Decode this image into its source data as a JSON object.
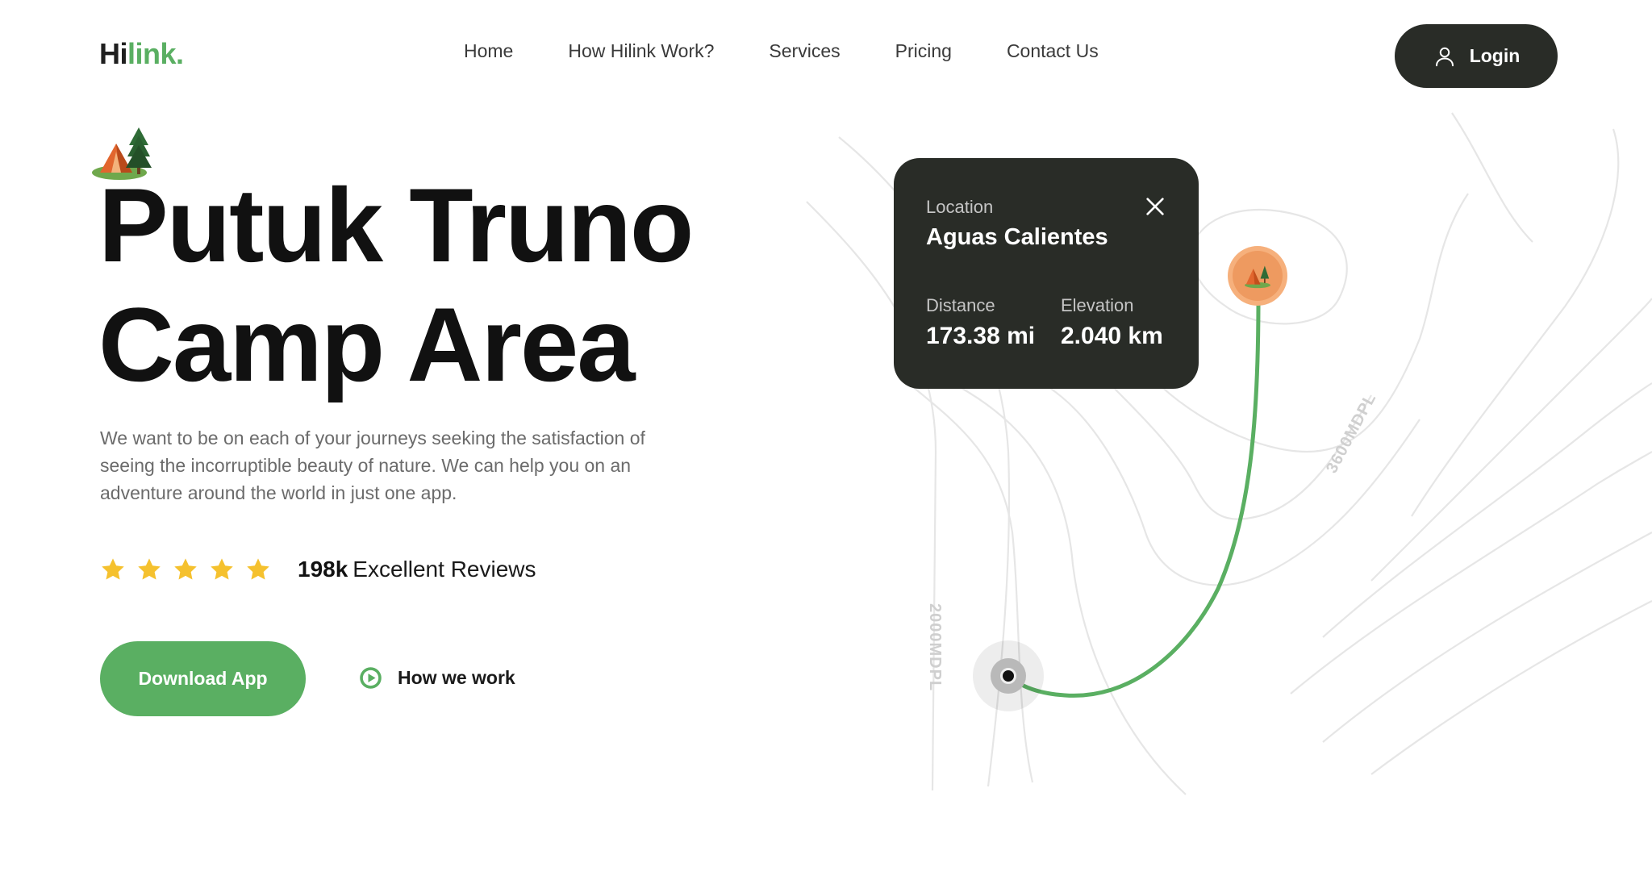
{
  "header": {
    "logo_part1": "Hi",
    "logo_part2": "link.",
    "nav": [
      "Home",
      "How Hilink Work?",
      "Services",
      "Pricing",
      "Contact Us"
    ],
    "login_label": "Login"
  },
  "hero": {
    "title_line1": "Putuk Truno",
    "title_line2": "Camp Area",
    "description": "We want to be on each of your journeys seeking the satisfaction of seeing the incorruptible beauty of nature. We can help you on an adventure around the world in just one app.",
    "rating_stars": 5,
    "review_count": "198k",
    "review_label": "Excellent Reviews",
    "download_label": "Download App",
    "how_label": "How we work"
  },
  "map": {
    "contour_label_1": "3600MDPL",
    "contour_label_2": "2000MDPL",
    "card": {
      "location_caption": "Location",
      "location_value": "Aguas Calientes",
      "distance_caption": "Distance",
      "distance_value": "173.38 mi",
      "elevation_caption": "Elevation",
      "elevation_value": "2.040 km"
    }
  },
  "icons": {
    "login": "user-icon",
    "camp": "tent-icon",
    "star": "star-icon",
    "play": "play-icon",
    "close": "close-icon"
  },
  "colors": {
    "brand_green": "#5aaf62",
    "dark": "#292c27",
    "star_yellow": "#f5c12e",
    "pin_orange": "#ee9a60"
  }
}
